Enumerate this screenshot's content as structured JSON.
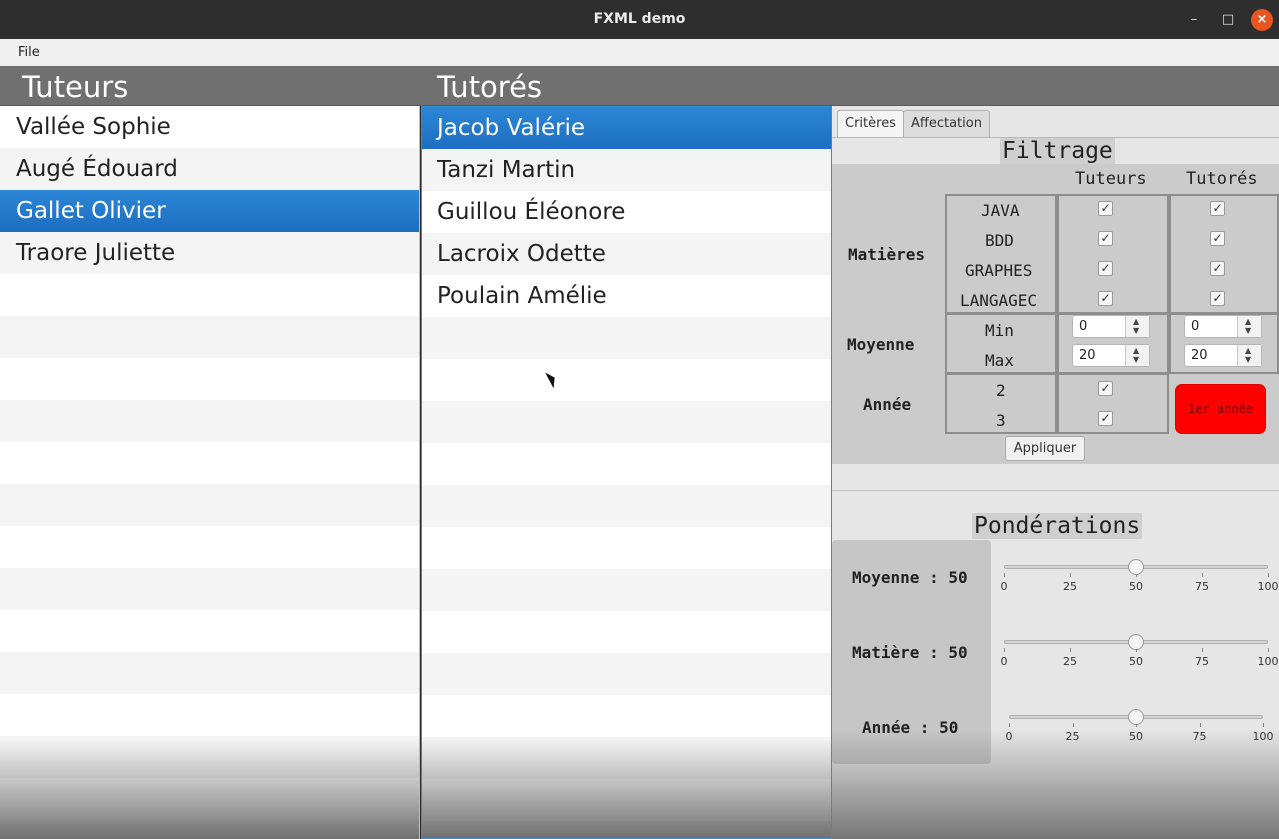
{
  "window": {
    "title": "FXML demo"
  },
  "menu": {
    "file": "File"
  },
  "headers": {
    "tuteurs": "Tuteurs",
    "tutores": "Tutorés"
  },
  "tuteurs": [
    "Vallée Sophie",
    "Augé Édouard",
    "Gallet Olivier",
    "Traore Juliette"
  ],
  "tuteurs_selected": 2,
  "tutores": [
    "Jacob Valérie",
    "Tanzi Martin",
    "Guillou Éléonore",
    "Lacroix Odette",
    "Poulain Amélie"
  ],
  "tutores_selected": 0,
  "tabs": [
    "Critères",
    "Affectation"
  ],
  "filtrage": {
    "title": "Filtrage",
    "col_tuteurs": "Tuteurs",
    "col_tutores": "Tutorés",
    "matieres_label": "Matières",
    "matieres": [
      "JAVA",
      "BDD",
      "GRAPHES",
      "LANGAGEC"
    ],
    "moyenne_label": "Moyenne",
    "min_label": "Min",
    "max_label": "Max",
    "tuteurs_min": "0",
    "tuteurs_max": "20",
    "tutores_min": "0",
    "tutores_max": "20",
    "annee_label": "Année",
    "annees": [
      "2",
      "3"
    ],
    "first_year_button": "1er année",
    "apply": "Appliquer"
  },
  "ponderations": {
    "title": "Pondérations",
    "items": [
      {
        "label": "Moyenne : 50",
        "value": 50
      },
      {
        "label": "Matière : 50",
        "value": 50
      },
      {
        "label": "Année : 50",
        "value": 50
      }
    ],
    "ticks": [
      "0",
      "25",
      "50",
      "75",
      "100"
    ]
  },
  "icons": {
    "check": "check-icon",
    "spin_up": "arrow-up-icon",
    "spin_down": "arrow-down-icon"
  },
  "colors": {
    "selection": "#1f74c8",
    "first_year_button": "#ff0000"
  }
}
